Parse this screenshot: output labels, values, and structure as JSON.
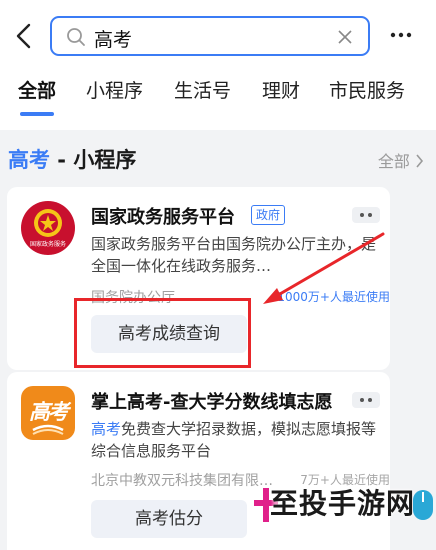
{
  "search": {
    "query": "高考"
  },
  "tabs": [
    "全部",
    "小程序",
    "生活号",
    "理财",
    "市民服务"
  ],
  "section": {
    "highlight": "高考",
    "suffix": " - 小程序",
    "more": "全部"
  },
  "results": [
    {
      "logo_text": "国家政务服务",
      "name": "国家政务服务平台",
      "badge": "政府",
      "description": "国家政务服务平台由国务院办公厅主办，是全国一体化在线政务服务…",
      "provider": "国务院办公厅",
      "users": "1000万+人最近使用",
      "service": "高考成绩查询"
    },
    {
      "logo_text": "高考",
      "name": "掌上高考-查大学分数线填志愿",
      "description_highlight": "高考",
      "description": "免费查大学招录数据，模拟志愿填报等综合信息服务平台",
      "provider": "北京中教双元科技集团有限…",
      "users": "7万+人最近使用",
      "service": "高考估分"
    }
  ],
  "watermark": {
    "text": "至投手游网"
  },
  "colors": {
    "accent": "#3b7cf5",
    "annotation": "#e8262a",
    "gov_logo": "#c8102e",
    "app_logo": "#f08a1a"
  }
}
